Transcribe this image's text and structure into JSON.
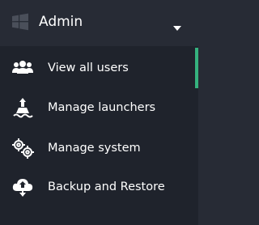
{
  "header": {
    "title": "Admin",
    "logo_icon": "windows-logo-icon",
    "dropdown_icon": "caret-down-icon"
  },
  "menu": {
    "items": [
      {
        "label": "View all users",
        "icon": "users-icon",
        "active": true
      },
      {
        "label": "Manage launchers",
        "icon": "launcher-icon",
        "active": false
      },
      {
        "label": "Manage system",
        "icon": "gears-icon",
        "active": false
      },
      {
        "label": "Backup and Restore",
        "icon": "cloud-upload-download-icon",
        "active": false
      }
    ]
  },
  "colors": {
    "header_bg": "#272b35",
    "menu_bg": "#1f232c",
    "active_indicator": "#35b27e",
    "text": "#ffffff"
  }
}
